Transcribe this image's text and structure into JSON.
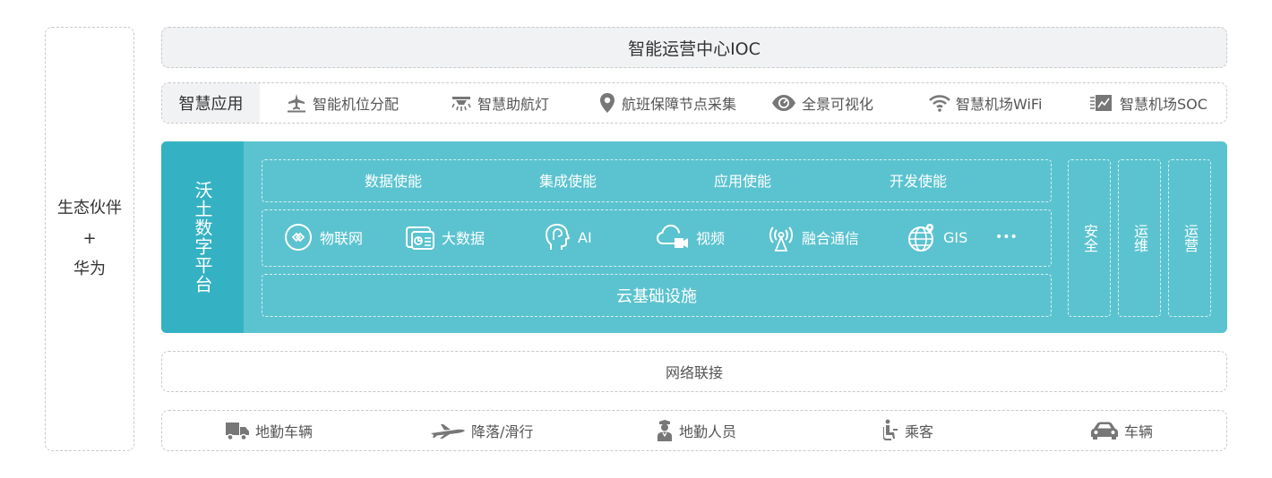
{
  "partner": {
    "line1": "生态伙伴",
    "plus": "+",
    "line2": "华为"
  },
  "ioc": {
    "title": "智能运营中心IOC"
  },
  "apps": {
    "label": "智慧应用",
    "items": [
      {
        "icon": "airplane-stand-icon",
        "label": "智能机位分配"
      },
      {
        "icon": "runway-light-icon",
        "label": "智慧助航灯"
      },
      {
        "icon": "location-pin-icon",
        "label": "航班保障节点采集"
      },
      {
        "icon": "eye-icon",
        "label": "全景可视化"
      },
      {
        "icon": "wifi-icon",
        "label": "智慧机场WiFi"
      },
      {
        "icon": "soc-dashboard-icon",
        "label": "智慧机场SOC"
      }
    ]
  },
  "platform": {
    "title": "沃土数字平台",
    "enablers": [
      "数据使能",
      "集成使能",
      "应用使能",
      "开发使能"
    ],
    "tech": [
      {
        "icon": "iot-icon",
        "label": "物联网"
      },
      {
        "icon": "big-data-icon",
        "label": "大数据"
      },
      {
        "icon": "ai-head-icon",
        "label": "AI"
      },
      {
        "icon": "cloud-video-icon",
        "label": "视频"
      },
      {
        "icon": "antenna-icon",
        "label": "融合通信"
      },
      {
        "icon": "globe-pin-icon",
        "label": "GIS"
      }
    ],
    "more": "•••",
    "cloud": "云基础设施",
    "side": [
      "安全",
      "运维",
      "运营"
    ]
  },
  "network": {
    "label": "网络联接"
  },
  "terminals": {
    "items": [
      {
        "icon": "truck-icon",
        "label": "地勤车辆"
      },
      {
        "icon": "plane-landing-icon",
        "label": "降落/滑行"
      },
      {
        "icon": "ground-staff-icon",
        "label": "地勤人员"
      },
      {
        "icon": "passenger-icon",
        "label": "乘客"
      },
      {
        "icon": "car-icon",
        "label": "车辆"
      }
    ]
  },
  "colors": {
    "platform": "#5bc3cf",
    "platform_title": "#34b2c3",
    "panel_bg": "#f1f2f4",
    "icon_gray": "#777777"
  }
}
